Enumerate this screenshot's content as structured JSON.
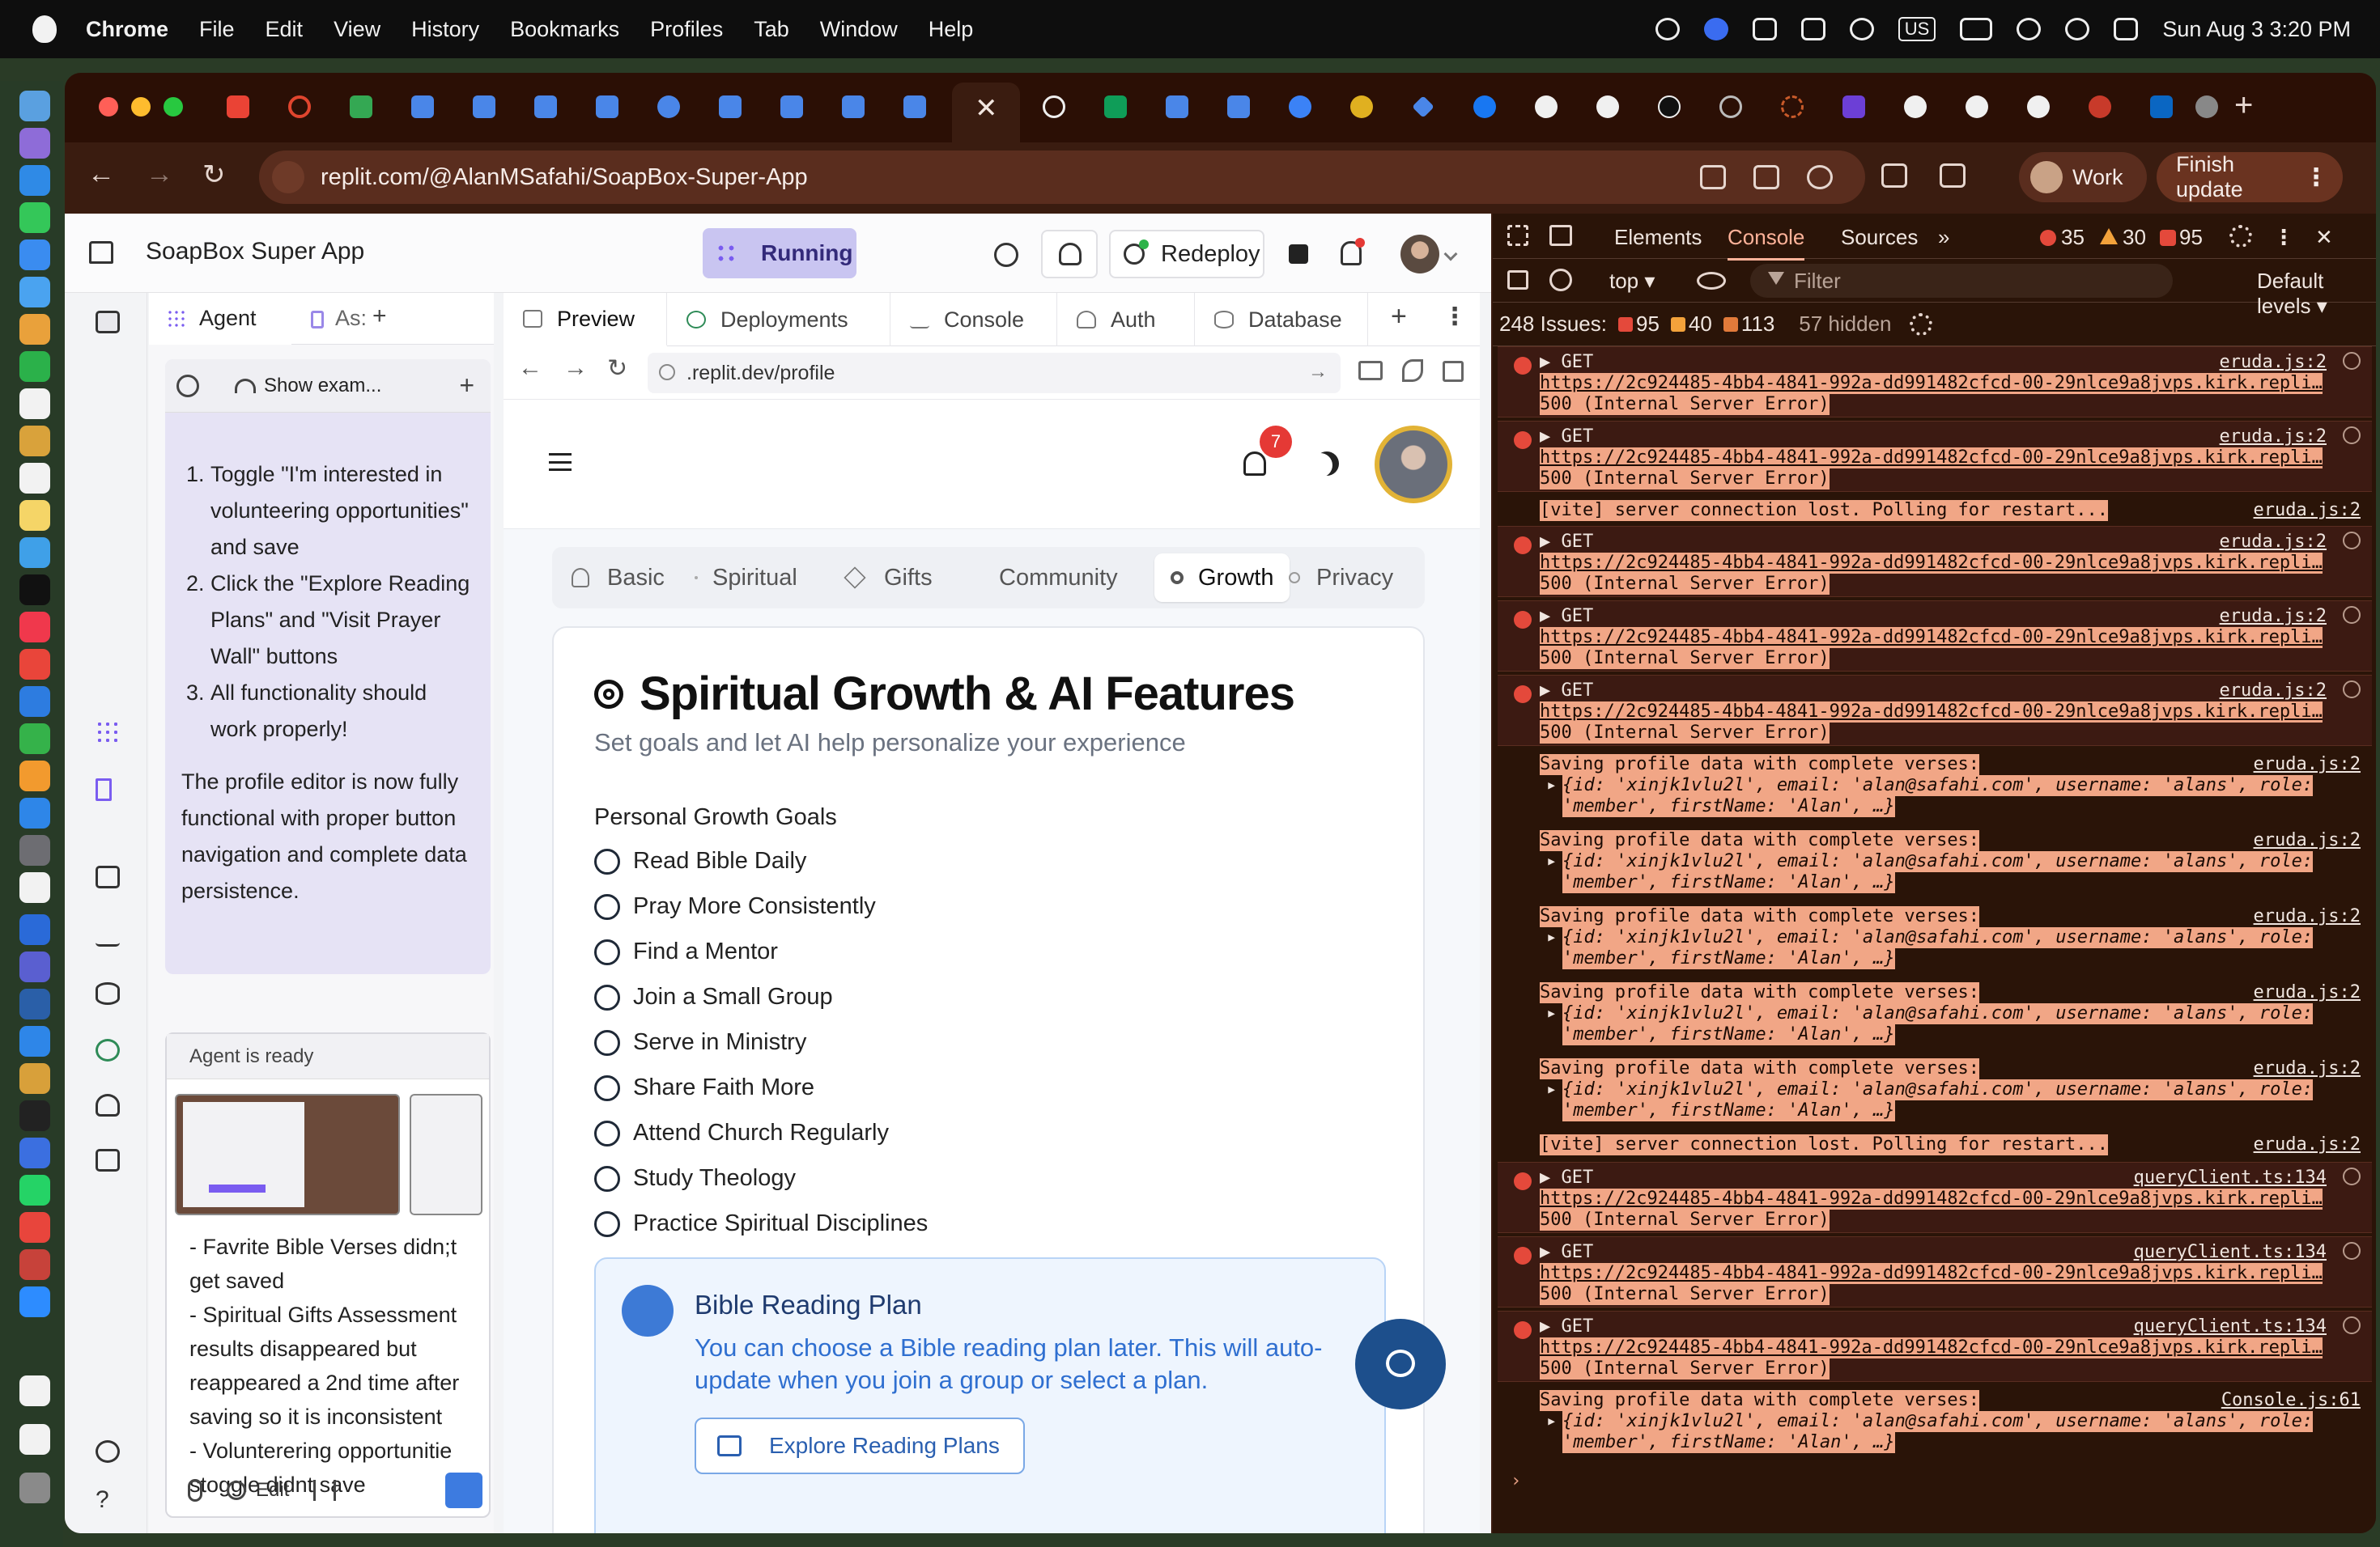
{
  "menubar": {
    "app": "Chrome",
    "items": [
      "File",
      "Edit",
      "View",
      "History",
      "Bookmarks",
      "Profiles",
      "Tab",
      "Window",
      "Help"
    ],
    "input_source": "US",
    "clock": "Sun Aug 3  3:20 PM"
  },
  "browser": {
    "url": "replit.com/@AlanMSafahi/SoapBox-Super-App",
    "profile_label": "Work",
    "finish_update_label": "Finish update",
    "close_glyph": "✕",
    "new_tab_glyph": "+",
    "back_glyph": "←",
    "forward_glyph": "→",
    "reload_glyph": "↻",
    "dots": "⋮"
  },
  "replit": {
    "project_title": "SoapBox Super App",
    "status": "Running",
    "redeploy_label": "Redeploy",
    "agent": {
      "tab_agent": "Agent",
      "tab_assistant": "As:",
      "add": "+",
      "show_examples": "Show exam...",
      "steps": [
        "Toggle \"I'm interested in volunteering opportunities\" and save",
        "Click the \"Explore Reading Plans\" and \"Visit Prayer Wall\" buttons",
        "All functionality should work properly!"
      ],
      "summary": "The profile editor is now fully functional with proper button navigation and complete data persistence.",
      "ready": "Agent is ready",
      "message": "- Favrite Bible Verses didn;t get saved\n- Spiritual Gifts Assessment results disappeared but reappeared a 2nd time after saving so it is inconsistent\n- Volunterering opportunitie stoggle didnt save",
      "edit_label": "Edit"
    },
    "panes": {
      "tabs": [
        "Preview",
        "Deployments",
        "Console",
        "Auth",
        "Database"
      ],
      "add": "+",
      "address": ".replit.dev/profile"
    },
    "app": {
      "notif_count": "7",
      "profile_tabs": [
        "Basic",
        "Spiritual",
        "Gifts",
        "Community",
        "Growth",
        "Privacy"
      ],
      "title": "Spiritual Growth & AI Features",
      "subtitle": "Set goals and let AI help personalize your experience",
      "goals_heading": "Personal Growth Goals",
      "goals": [
        "Read Bible Daily",
        "Pray More Consistently",
        "Find a Mentor",
        "Join a Small Group",
        "Serve in Ministry",
        "Share Faith More",
        "Attend Church Regularly",
        "Study Theology",
        "Practice Spiritual Disciplines"
      ],
      "reading": {
        "title": "Bible Reading Plan",
        "desc": "You can choose a Bible reading plan later. This will auto-update when you join a group or select a plan.",
        "button": "Explore Reading Plans"
      }
    }
  },
  "devtools": {
    "tabs": [
      "Elements",
      "Console",
      "Sources"
    ],
    "more": "»",
    "counts": {
      "errors": "35",
      "warnings": "30",
      "info": "95"
    },
    "context": "top ▾",
    "filter": "Filter",
    "levels": "Default levels ▾",
    "issues": {
      "label": "248 Issues:",
      "errors": "95",
      "warnings": "40",
      "info": "113",
      "hidden": "57 hidden"
    },
    "prompt": "›",
    "get": "GET",
    "url": "https://2c924485-4bb4-4841-992a-dd991482cfcd-00-29nlce9a8jvps.kirk.repli…",
    "err500": "500 (Internal Server Error)",
    "vite": "[vite] server connection lost. Polling for restart...",
    "saving": "Saving profile data with complete verses:",
    "obj1": "{id: 'xinjk1vlu2l', email: 'alan@safahi.com', username: 'alans', role:",
    "obj2": "'member', firstName: 'Alan', …}",
    "src_eruda": "eruda.js:2",
    "src_query": "queryClient.ts:134",
    "src_console": "Console.js:61"
  }
}
